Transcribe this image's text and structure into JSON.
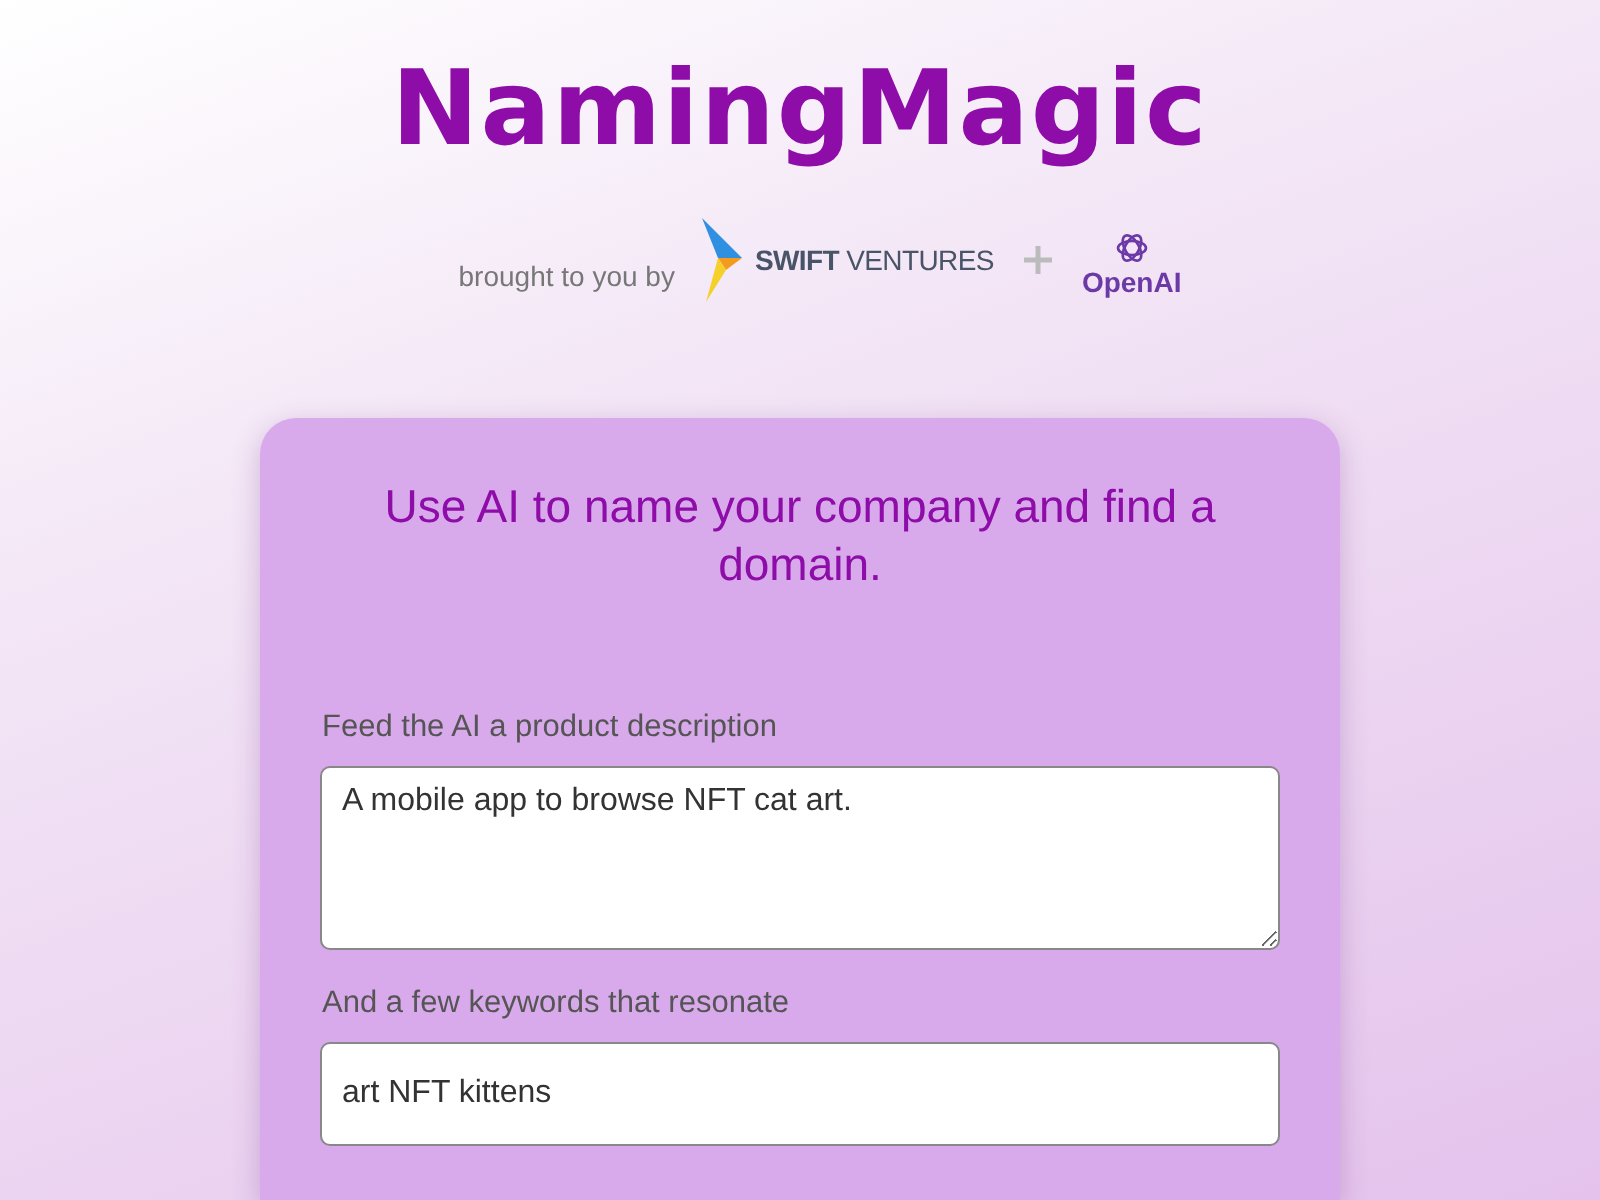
{
  "app_title": "NamingMagic",
  "byline": {
    "text": "brought to you by",
    "partner_1": {
      "word_1": "SWIFT",
      "word_2": "VENTURES"
    },
    "partner_2": "OpenAI"
  },
  "card": {
    "heading": "Use AI to name your company and find a domain.",
    "fields": [
      {
        "kind": "textarea",
        "label": "Feed the AI a product description",
        "value": "A mobile app to browse NFT cat art."
      },
      {
        "kind": "input",
        "label": "And a few keywords that resonate",
        "value": "art NFT kittens"
      }
    ]
  }
}
